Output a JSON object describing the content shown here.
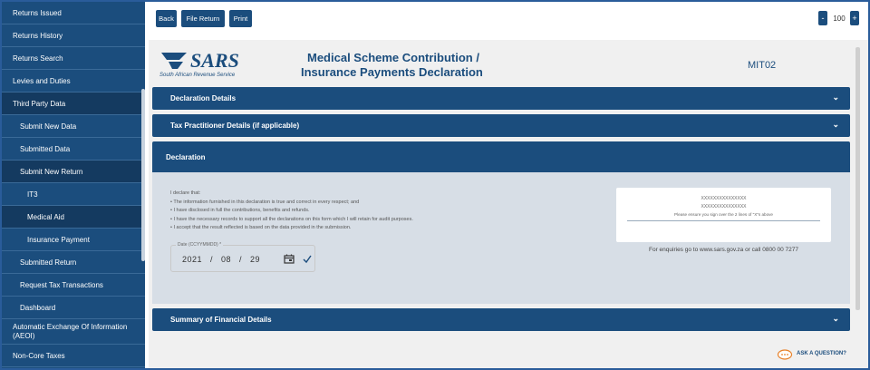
{
  "sidebar": {
    "items": [
      {
        "label": "Returns Issued"
      },
      {
        "label": "Returns History"
      },
      {
        "label": "Returns Search"
      },
      {
        "label": "Levies and Duties"
      },
      {
        "label": "Third Party Data"
      },
      {
        "label": "Submit New Data"
      },
      {
        "label": "Submitted Data"
      },
      {
        "label": "Submit New Return"
      },
      {
        "label": "IT3"
      },
      {
        "label": "Medical Aid"
      },
      {
        "label": "Insurance Payment"
      },
      {
        "label": "Submitted Return"
      },
      {
        "label": "Request Tax Transactions"
      },
      {
        "label": "Dashboard"
      },
      {
        "label": "Automatic Exchange Of Information (AEOI)"
      },
      {
        "label": "Non-Core Taxes"
      }
    ]
  },
  "toolbar": {
    "back_label": "Back",
    "file_return_label": "File Return",
    "print_label": "Print",
    "zoom_minus": "-",
    "zoom_value": "100",
    "zoom_plus": "+"
  },
  "header": {
    "logo_text": "SARS",
    "logo_subtitle": "South African Revenue Service",
    "title_line1": "Medical Scheme Contribution /",
    "title_line2": "Insurance Payments Declaration",
    "form_code": "MIT02"
  },
  "sections": {
    "declaration_details": "Declaration Details",
    "tax_practitioner": "Tax Practitioner Details (if applicable)",
    "declaration": "Declaration",
    "summary": "Summary of Financial Details"
  },
  "declaration": {
    "lines": [
      "I declare that:",
      "• The information furnished in this declaration is true and correct in every respect; and",
      "• I have disclosed in full the contributions, benefits and refunds.",
      "• I have the necessary records to support all the declarations on this form which I will retain for audit purposes.",
      "• I accept that the result reflected is based on the data provided in the submission."
    ],
    "date_label": "Date (CCYYMMDD) *",
    "date_value": "2021 / 08 / 29",
    "signature_x1": "XXXXXXXXXXXXXXX",
    "signature_x2": "XXXXXXXXXXXXXXX",
    "signature_note": "Please ensure you sign over the 2 lines of \"X\"s above",
    "enquiries": "For enquiries go to www.sars.gov.za or call 0800 00 7277"
  },
  "help": {
    "ask_label": "ASK A QUESTION?"
  },
  "colors": {
    "brand_blue": "#1b4d7d",
    "panel_grey": "#d7dee6"
  }
}
